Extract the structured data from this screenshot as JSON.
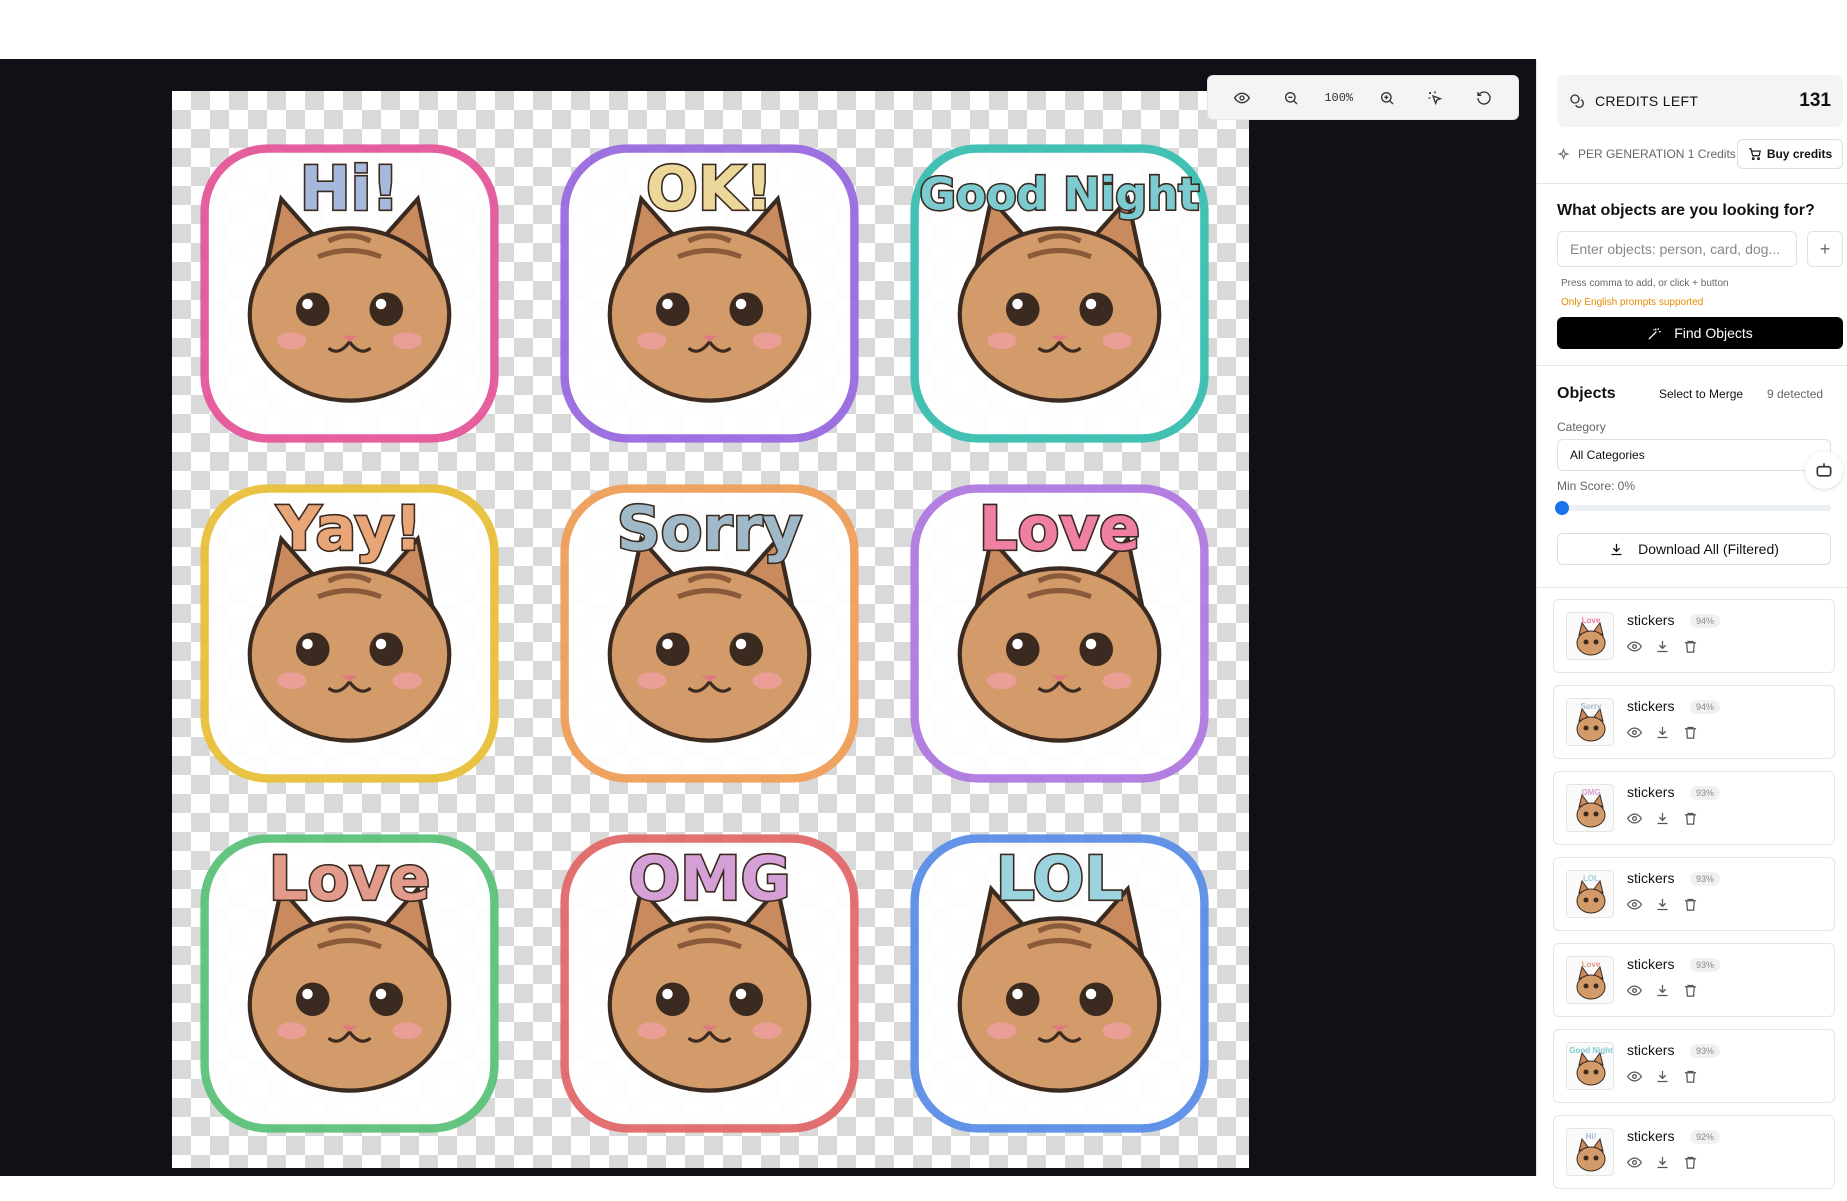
{
  "toolbar": {
    "zoom": "100%",
    "icons": [
      "eye-icon",
      "zoom-out-icon",
      "zoom-in-icon",
      "select-pointer-icon",
      "reset-icon"
    ]
  },
  "stickers": [
    {
      "text": "Hi!",
      "outline": "#e5579a",
      "text_color": "#a6b8dc"
    },
    {
      "text": "OK!",
      "outline": "#9a6be0",
      "text_color": "#ecd79a"
    },
    {
      "text": "Good Night",
      "outline": "#39bfb1",
      "text_color": "#7ccbd0"
    },
    {
      "text": "Yay!",
      "outline": "#e9c03a",
      "text_color": "#e8a678"
    },
    {
      "text": "Sorry",
      "outline": "#f0a05a",
      "text_color": "#9fb9c9"
    },
    {
      "text": "Love",
      "outline": "#b07ae0",
      "text_color": "#f07fa4"
    },
    {
      "text": "Love",
      "outline": "#5cc27a",
      "text_color": "#e29a8a"
    },
    {
      "text": "OMG",
      "outline": "#e26a6a",
      "text_color": "#d4a0d6"
    },
    {
      "text": "LOL",
      "outline": "#5b8fe6",
      "text_color": "#9bd3df"
    }
  ],
  "sidebar": {
    "credits_label": "CREDITS LEFT",
    "credits_value": "131",
    "per_generation": "PER GENERATION 1 Credits",
    "buy_label": "Buy credits",
    "question": "What objects are you looking for?",
    "input_placeholder": "Enter objects: person, card, dog...",
    "hint": "Press comma to add, or click + button",
    "warning": "Only English prompts supported",
    "find_label": "Find Objects",
    "objects_title": "Objects",
    "merge_label": "Select to Merge",
    "detected": "9 detected",
    "category_label": "Category",
    "category_value": "All Categories",
    "min_score_label": "Min Score: 0%",
    "min_score": 0,
    "download_all": "Download All (Filtered)",
    "accent": "#1a73e8"
  },
  "objects": [
    {
      "name": "stickers",
      "score": "94%",
      "thumb": "Love",
      "thumb_color": "#f07fa4"
    },
    {
      "name": "stickers",
      "score": "94%",
      "thumb": "Sorry",
      "thumb_color": "#9fb9c9"
    },
    {
      "name": "stickers",
      "score": "93%",
      "thumb": "OMG",
      "thumb_color": "#d4a0d6"
    },
    {
      "name": "stickers",
      "score": "93%",
      "thumb": "LOL",
      "thumb_color": "#9bd3df"
    },
    {
      "name": "stickers",
      "score": "93%",
      "thumb": "Love",
      "thumb_color": "#e29a8a"
    },
    {
      "name": "stickers",
      "score": "93%",
      "thumb": "Good Night",
      "thumb_color": "#7ccbd0"
    },
    {
      "name": "stickers",
      "score": "92%",
      "thumb": "Hi!",
      "thumb_color": "#a6b8dc"
    }
  ]
}
